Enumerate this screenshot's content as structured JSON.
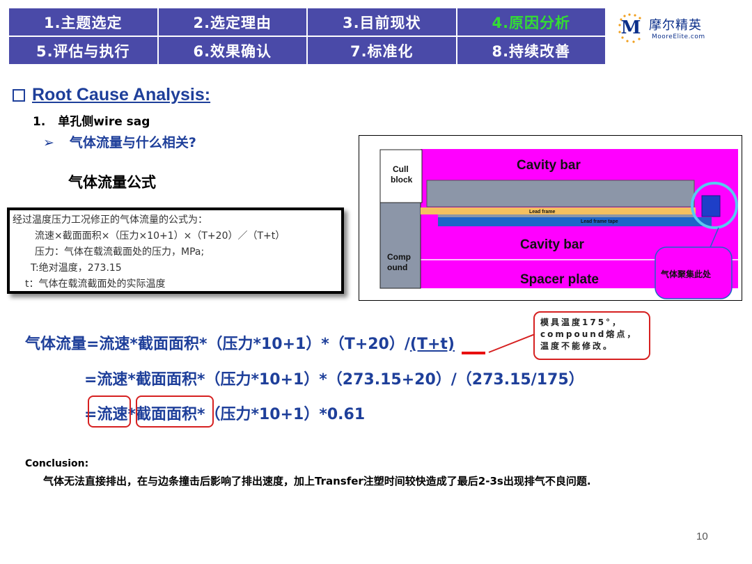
{
  "nav": {
    "items": [
      {
        "label": "1.主题选定"
      },
      {
        "label": "2.选定理由"
      },
      {
        "label": "3.目前现状"
      },
      {
        "label": "4.原因分析"
      },
      {
        "label": "5.评估与执行"
      },
      {
        "label": "6.效果确认"
      },
      {
        "label": "7.标准化"
      },
      {
        "label": "8.持续改善"
      }
    ],
    "active_label": "4.原因分析",
    "bg_color": "#4a4aa8",
    "active_color": "#33dd33"
  },
  "logo": {
    "mark": "M",
    "cn": "摩尔精英",
    "en": "MooreElite.com"
  },
  "heading": "Root Cause Analysis:",
  "item1": {
    "num": "1.",
    "text": "单孔侧wire sag"
  },
  "bullet": {
    "symbol": "➢",
    "text": "气体流量与什么相关?"
  },
  "formula_title": "气体流量公式",
  "formula_box": {
    "lines": [
      "经过温度压力工况修正的气体流量的公式为：",
      "流速×截面面积×（压力×10+1）×（T+20）／（T+t）",
      "压力：气体在载流截面处的压力，MPa;",
      "T:绝对温度，273.15",
      "t：气体在载流截面处的实际温度"
    ]
  },
  "diagram": {
    "cull_block": "Cull\nblock",
    "cavity_bar_top": "Cavity bar",
    "lead_frame": "Lead frame",
    "lead_frame_tape": "Lead frame tape",
    "cavity_bar_bottom": "Cavity bar",
    "compound": "Comp\nound",
    "spacer_plate": "Spacer plate",
    "gas_note": "气体聚集此处",
    "colors": {
      "magenta": "#ff00ff",
      "gray": "#8c96a8",
      "orange": "#f5c060",
      "blue": "#1e64c8",
      "cyan": "#5ac8f0"
    }
  },
  "main_formula": {
    "line1_prefix": "气体流量=流速*截面面积*（压力*10+1）*（T+20）/",
    "line1_tt": "(T+t)",
    "line2": "=流速*截面面积*（压力*10+1）*（273.15+20）/（273.15/175）",
    "line3_eq": "=",
    "line3_a": "流速",
    "line3_star": "*",
    "line3_b": "截面面积",
    "line3_rest": "*（压力*10+1）*0.61"
  },
  "callout": {
    "text": "模具温度175°，compound熔点，温度不能修改。"
  },
  "conclusion": {
    "title": "Conclusion:",
    "text": "气体无法直接排出，在与边条撞击后影响了排出速度，加上Transfer注塑时间较快造成了最后2-3s出现排气不良问题."
  },
  "page_number": "10"
}
